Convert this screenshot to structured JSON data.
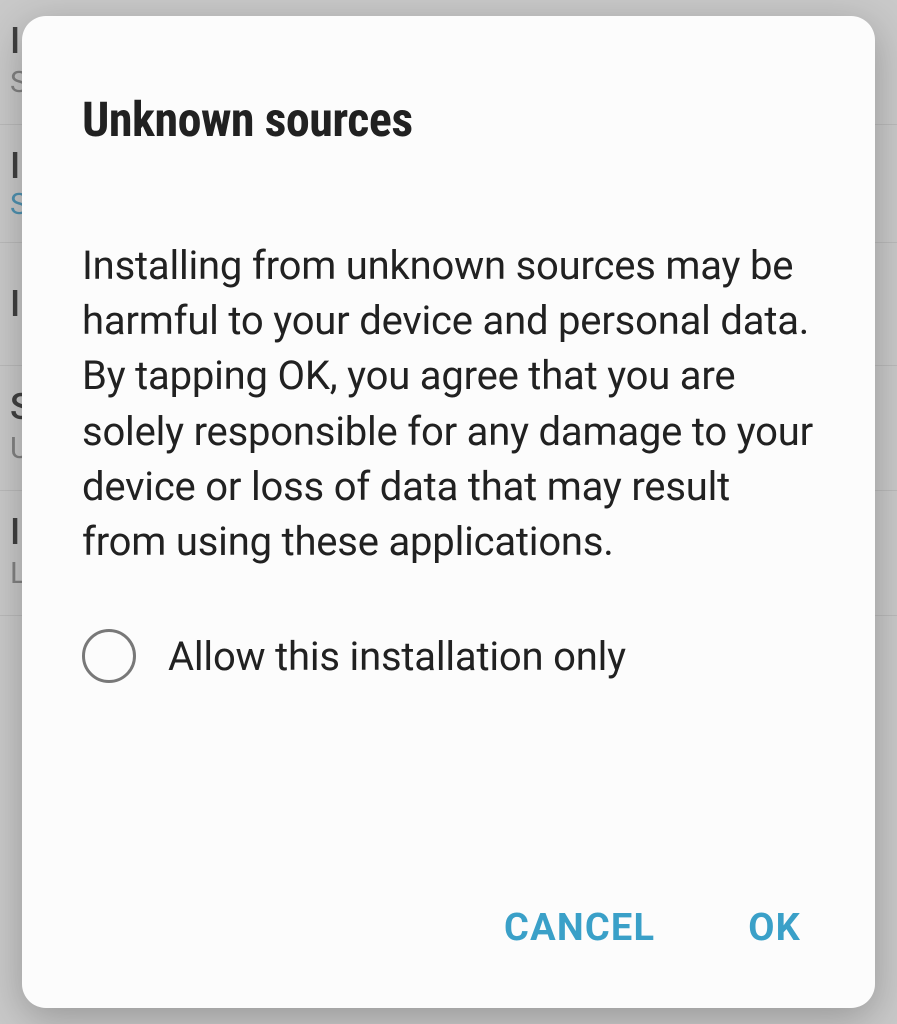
{
  "dialog": {
    "title": "Unknown sources",
    "body": "Installing from unknown sources may be harmful to your device and personal data. By tapping OK, you agree that you are solely respons­ible for any damage to your device or loss of data that may result from using these applications.",
    "checkbox_label": "Allow this installation only",
    "checkbox_checked": false,
    "actions": {
      "cancel": "CANCEL",
      "ok": "OK"
    }
  },
  "colors": {
    "accent": "#3aa0c8",
    "text_primary": "#212121",
    "radio_border": "#787878"
  },
  "background": {
    "item1_letter": "I",
    "item1_sub": "S\ni",
    "item2_letter": "I",
    "item2_sub_blue": "S",
    "item3_letter": "I",
    "item4_letter": "S",
    "item4_sub": "U\ne",
    "item5_letter": "I",
    "item5_sub": "L\nS"
  }
}
